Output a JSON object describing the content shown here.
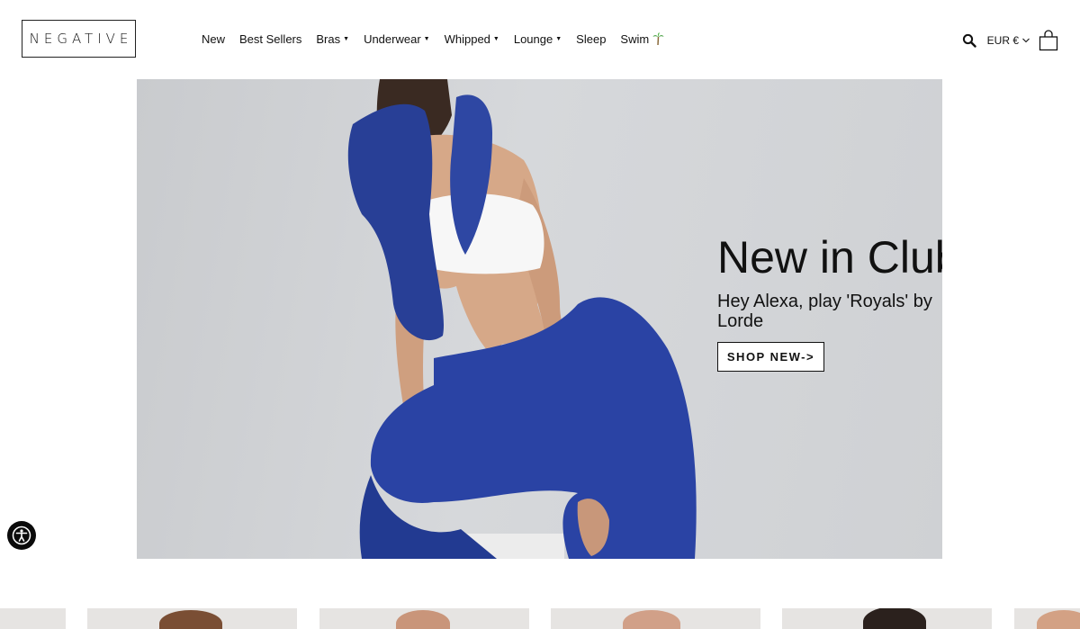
{
  "header": {
    "logo_text": "NEGATIVE",
    "nav": [
      {
        "label": "New",
        "dropdown": false
      },
      {
        "label": "Best Sellers",
        "dropdown": false
      },
      {
        "label": "Bras",
        "dropdown": true
      },
      {
        "label": "Underwear",
        "dropdown": true
      },
      {
        "label": "Whipped",
        "dropdown": true
      },
      {
        "label": "Lounge",
        "dropdown": true
      },
      {
        "label": "Sleep",
        "dropdown": false
      },
      {
        "label": "Swim",
        "dropdown": false,
        "icon": "palm-tree-icon"
      }
    ],
    "currency": "EUR €",
    "icons": {
      "search": "search-icon",
      "bag": "shopping-bag-icon",
      "currency_chevron": "chevron-down-icon"
    }
  },
  "hero": {
    "title": "New in Club",
    "subtitle": "Hey Alexa, play 'Royals' by Lorde",
    "cta": "SHOP NEW->"
  },
  "accessibility": {
    "icon": "accessibility-icon"
  },
  "products": {
    "count_visible": 6
  },
  "colors": {
    "background": "#ffffff",
    "text": "#111111",
    "hero_bg": "#d2d4d7",
    "sweater_blue": "#283f96",
    "skin": "#d6a888"
  }
}
